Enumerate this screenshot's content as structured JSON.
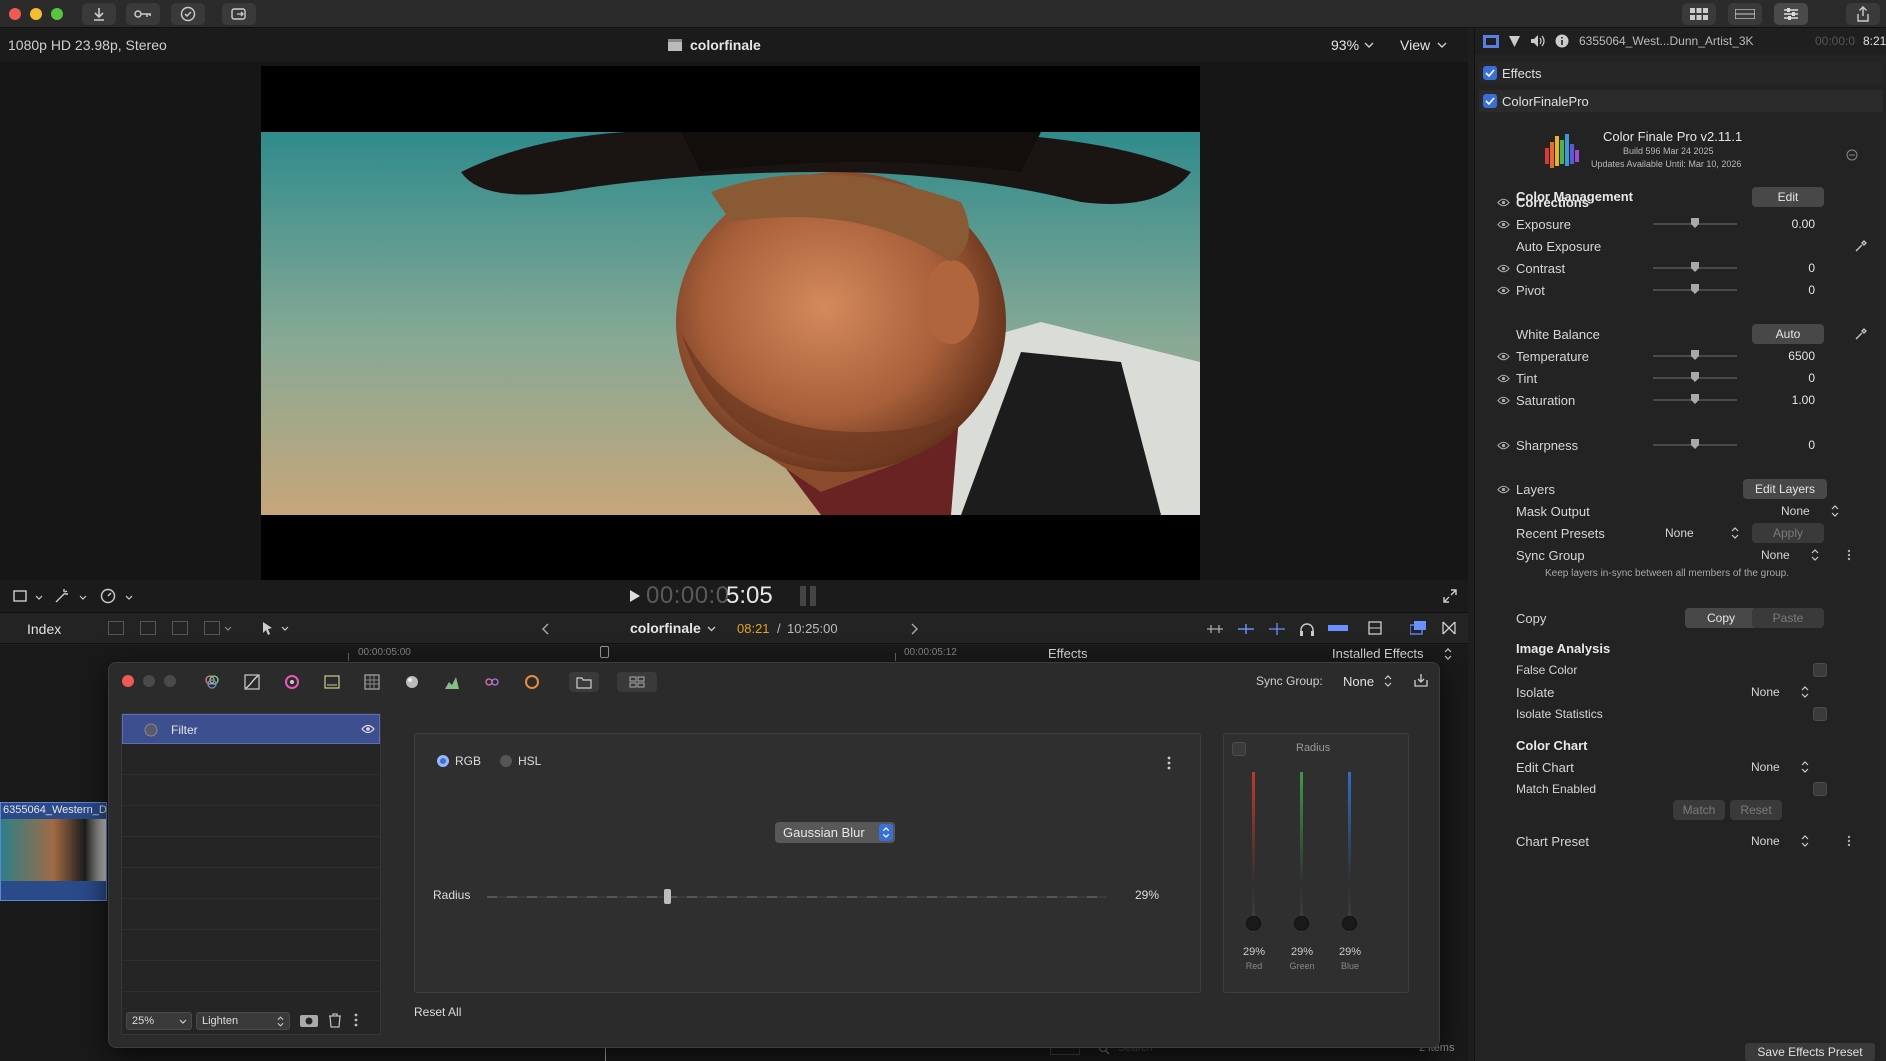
{
  "titlebar": {
    "buttons": [
      "import-icon",
      "key-icon",
      "checkmark-icon",
      "share-icon"
    ],
    "right_buttons": [
      "grid-icon",
      "filmstrip-icon",
      "sliders-icon",
      "export-icon"
    ]
  },
  "viewer": {
    "format": "1080p HD 23.98p, Stereo",
    "project_name": "colorfinale",
    "zoom": "93%",
    "view_label": "View"
  },
  "transport": {
    "timecode_dim": "00:00:0",
    "timecode_bright": "5:05"
  },
  "timeline_bar": {
    "index_label": "Index",
    "project_name": "colorfinale",
    "current_time": "08:21",
    "separator": "/",
    "duration": "10:25:00",
    "ruler_marks": [
      "00:00:05:00",
      "00:00:05:12"
    ],
    "effects_label": "Effects",
    "installed_effects": "Installed Effects",
    "clip_name": "6355064_Western_D",
    "items_count": "2 items",
    "search_placeholder": "Search"
  },
  "filter_window": {
    "sync_group_label": "Sync Group:",
    "sync_group_value": "None",
    "layer_name": "Filter",
    "opacity": "25%",
    "blend_mode": "Lighten",
    "reset_all": "Reset All",
    "mode_rgb": "RGB",
    "mode_hsl": "HSL",
    "filter_type": "Gaussian Blur",
    "radius_label": "Radius",
    "radius_value": "29%",
    "radius_fraction": 0.29,
    "side_title": "Radius",
    "channels": [
      {
        "value": "29%",
        "name": "Red",
        "color": "#c0392b"
      },
      {
        "value": "29%",
        "name": "Green",
        "color": "#3f9a4a"
      },
      {
        "value": "29%",
        "name": "Blue",
        "color": "#2f6fc4"
      }
    ]
  },
  "inspector": {
    "clip_title": "6355064_West...Dunn_Artist_3K",
    "clip_time_dim": "00:00:0",
    "clip_time": "8:21",
    "effects_label": "Effects",
    "plugin_label": "ColorFinalePro",
    "plugin_name": "Color Finale Pro v2.11.1",
    "plugin_build": "Build 596 Mar 24 2025",
    "plugin_updates": "Updates Available Until: Mar 10, 2026",
    "color_management": "Color Management",
    "edit_label": "Edit",
    "corrections": "Corrections",
    "exposure": {
      "label": "Exposure",
      "value": "0.00"
    },
    "auto_exposure": "Auto Exposure",
    "contrast": {
      "label": "Contrast",
      "value": "0"
    },
    "pivot": {
      "label": "Pivot",
      "value": "0"
    },
    "white_balance": "White Balance",
    "auto_label": "Auto",
    "temperature": {
      "label": "Temperature",
      "value": "6500"
    },
    "tint": {
      "label": "Tint",
      "value": "0"
    },
    "saturation": {
      "label": "Saturation",
      "value": "1.00"
    },
    "sharpness": {
      "label": "Sharpness",
      "value": "0"
    },
    "layers": "Layers",
    "edit_layers": "Edit Layers",
    "mask_output": {
      "label": "Mask Output",
      "value": "None"
    },
    "recent_presets": {
      "label": "Recent Presets",
      "value": "None"
    },
    "apply_label": "Apply",
    "sync_group": {
      "label": "Sync Group",
      "value": "None"
    },
    "sync_note": "Keep layers in-sync between all members of the group.",
    "copy_label": "Copy",
    "copy_button": "Copy",
    "paste_button": "Paste",
    "image_analysis": "Image Analysis",
    "false_color": "False Color",
    "isolate": {
      "label": "Isolate",
      "value": "None"
    },
    "isolate_statistics": "Isolate Statistics",
    "color_chart": "Color Chart",
    "edit_chart": {
      "label": "Edit Chart",
      "value": "None"
    },
    "match_enabled": "Match Enabled",
    "match_button": "Match",
    "reset_button": "Reset",
    "chart_preset": {
      "label": "Chart Preset",
      "value": "None"
    },
    "save_effects_preset": "Save Effects Preset"
  }
}
